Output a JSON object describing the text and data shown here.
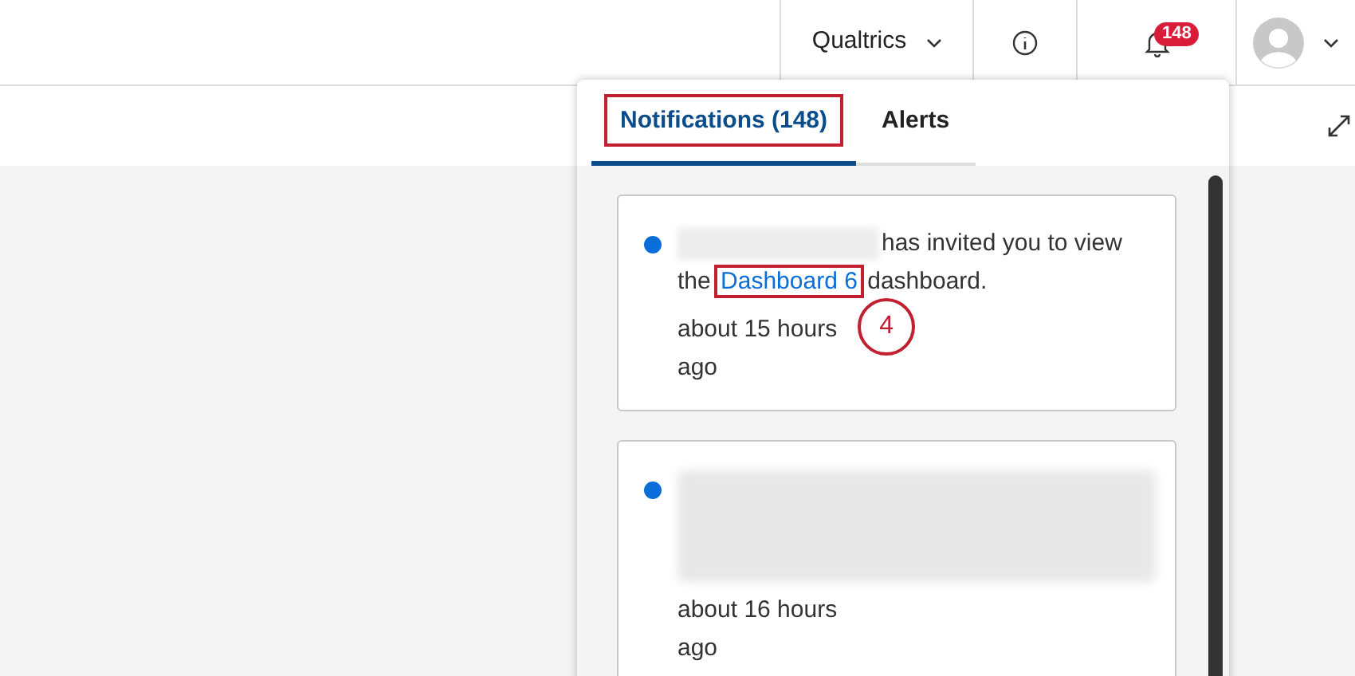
{
  "header": {
    "org_menu": "Qualtrics",
    "notification_count": "148"
  },
  "notifications_panel": {
    "tabs": [
      {
        "label": "Notifications (148)",
        "selected": true,
        "highlighted": true
      },
      {
        "label": "Alerts",
        "selected": false,
        "highlighted": false
      }
    ],
    "items": [
      {
        "kind": "invite",
        "unread": true,
        "text_before": "has invited you to view the",
        "link": "Dashboard 6",
        "link_highlighted": true,
        "callout": "4",
        "text_after": "dashboard.",
        "time": "about 15 hours ago"
      },
      {
        "kind": "redacted",
        "unread": true,
        "time": "about 16 hours ago"
      }
    ]
  }
}
